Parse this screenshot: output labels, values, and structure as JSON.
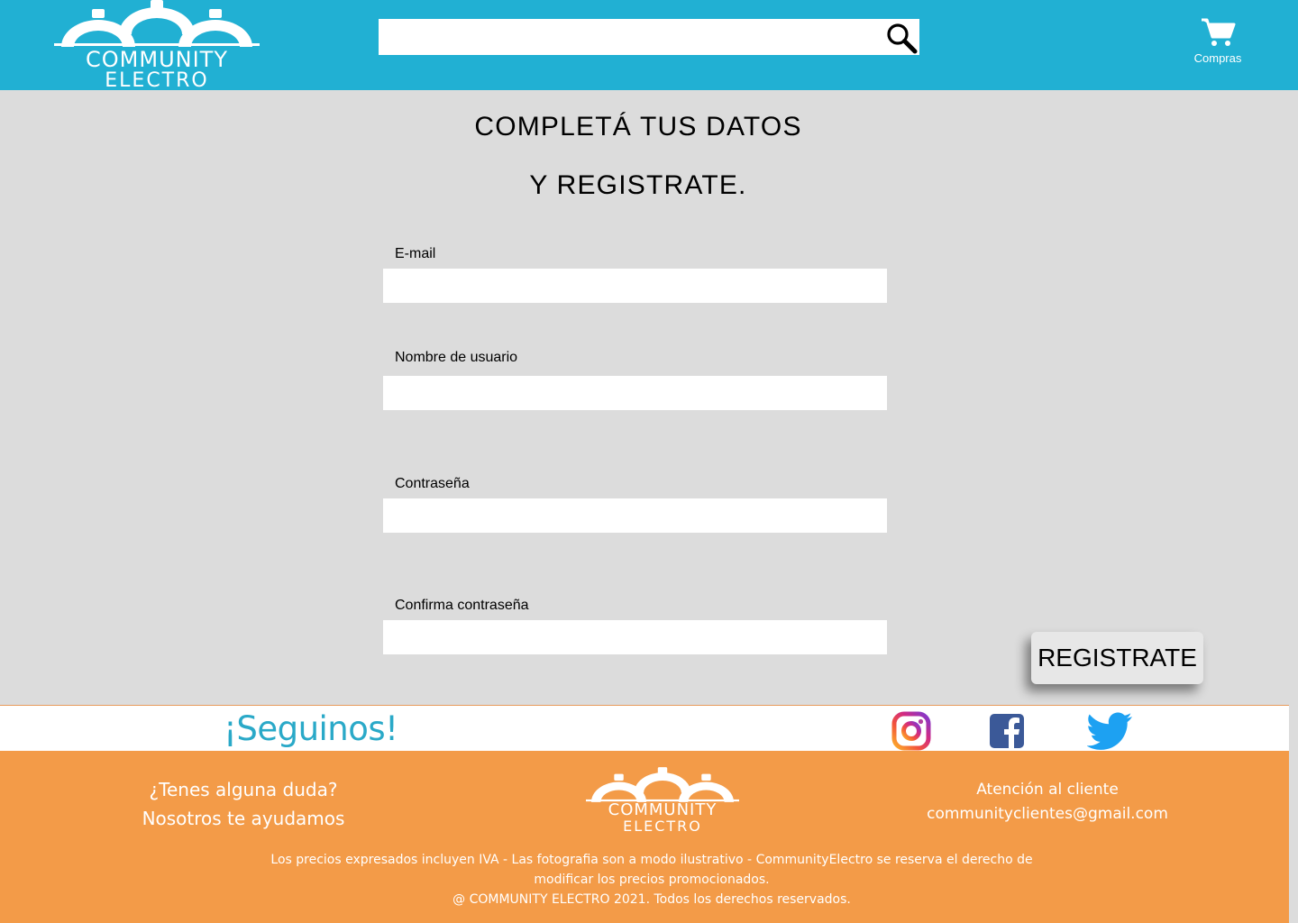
{
  "header": {
    "logo": {
      "line1": "COMMUNITY",
      "line2": "ELECTRO"
    },
    "search": {
      "value": "",
      "placeholder": ""
    },
    "cart": {
      "label": "Compras"
    },
    "colors": {
      "background": "#21b0d3"
    }
  },
  "main": {
    "title_line1": "COMPLETÁ TUS DATOS",
    "title_line2": "Y REGISTRATE.",
    "fields": [
      {
        "label": "E-mail",
        "value": ""
      },
      {
        "label": "Nombre de usuario",
        "value": ""
      },
      {
        "label": "Contraseña",
        "value": ""
      },
      {
        "label": "Confirma contraseña",
        "value": ""
      }
    ],
    "submit_label": "REGISTRATE"
  },
  "follow": {
    "title": "¡Seguinos!",
    "networks": [
      {
        "name": "instagram",
        "icon": "instagram-icon"
      },
      {
        "name": "facebook",
        "icon": "facebook-icon"
      },
      {
        "name": "twitter",
        "icon": "twitter-icon"
      }
    ]
  },
  "footer": {
    "help_line1": "¿Tenes alguna duda?",
    "help_line2": "Nosotros te ayudamos",
    "logo": {
      "line1": "COMMUNITY",
      "line2": "ELECTRO"
    },
    "contact_title": "Atención al cliente",
    "contact_email": "communityclientes@gmail.com",
    "legal_line1": "Los precios expresados incluyen IVA - Las fotografia son a modo ilustrativo - CommunityElectro se reserva el derecho de",
    "legal_line2": "modificar los precios promocionados.",
    "legal_line3": "@ COMMUNITY ELECTRO 2021. Todos los derechos reservados.",
    "colors": {
      "background": "#f39b48",
      "follow_text": "#2aa9c8"
    }
  }
}
